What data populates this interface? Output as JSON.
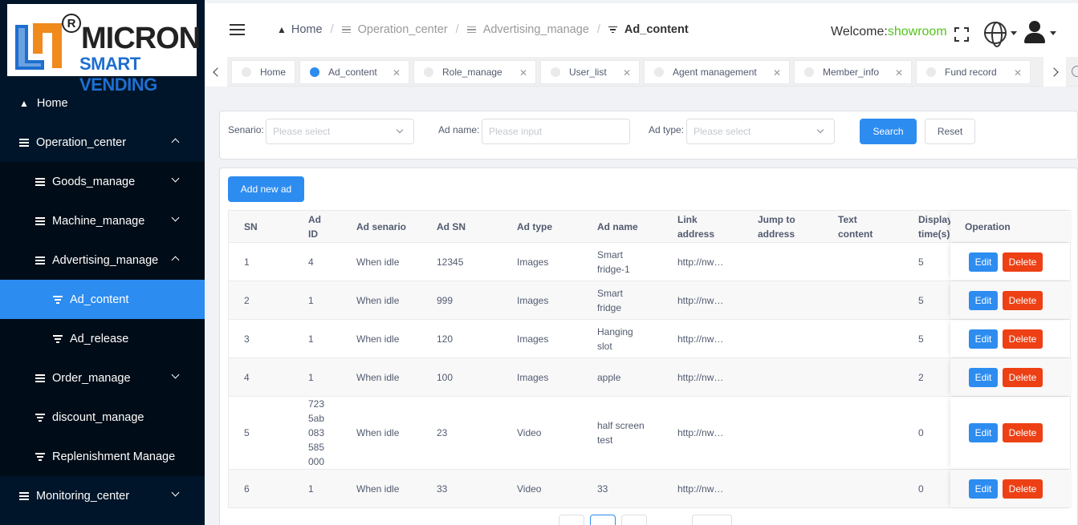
{
  "logo": {
    "mark_letters": "LM",
    "reg": "R",
    "brand": "MICRON",
    "tagline": "SMART VENDING"
  },
  "sidebar": {
    "items": [
      {
        "label": "Home"
      },
      {
        "label": "Operation_center"
      },
      {
        "label": "Goods_manage"
      },
      {
        "label": "Machine_manage"
      },
      {
        "label": "Advertising_manage"
      },
      {
        "label": "Ad_content"
      },
      {
        "label": "Ad_release"
      },
      {
        "label": "Order_manage"
      },
      {
        "label": "discount_manage"
      },
      {
        "label": "Replenishment Manage"
      },
      {
        "label": "Monitoring_center"
      }
    ]
  },
  "header": {
    "breadcrumb": [
      "Home",
      "Operation_center",
      "Advertising_manage",
      "Ad_content"
    ],
    "separator": "/",
    "welcome_prefix": "Welcome:",
    "username": "showroom"
  },
  "tags": [
    {
      "label": "Home"
    },
    {
      "label": "Ad_content"
    },
    {
      "label": "Role_manage"
    },
    {
      "label": "User_list"
    },
    {
      "label": "Agent management"
    },
    {
      "label": "Member_info"
    },
    {
      "label": "Fund record"
    }
  ],
  "search": {
    "senario_label": "Senario:",
    "senario_placeholder": "Please select",
    "adname_label": "Ad name:",
    "adname_placeholder": "Please input",
    "adtype_label": "Ad type:",
    "adtype_placeholder": "Please select",
    "search_label": "Search",
    "reset_label": "Reset"
  },
  "table": {
    "add_label": "Add new ad",
    "columns": [
      "SN",
      "Ad ID",
      "Ad senario",
      "Ad SN",
      "Ad type",
      "Ad name",
      "Link address",
      "Jump to address",
      "Text content",
      "Display time(s)",
      "Operation"
    ],
    "edit_label": "Edit",
    "delete_label": "Delete",
    "rows": [
      {
        "sn": "1",
        "ad_id": "4",
        "senario": "When idle",
        "ad_sn": "12345",
        "type": "Images",
        "name": "Smart fridge-1",
        "link": "http://nw…",
        "jump": "",
        "text": "",
        "time": "5"
      },
      {
        "sn": "2",
        "ad_id": "1",
        "senario": "When idle",
        "ad_sn": "999",
        "type": "Images",
        "name": "Smart fridge",
        "link": "http://nw…",
        "jump": "",
        "text": "",
        "time": "5"
      },
      {
        "sn": "3",
        "ad_id": "1",
        "senario": "When idle",
        "ad_sn": "120",
        "type": "Images",
        "name": "Hanging slot",
        "link": "http://nw…",
        "jump": "",
        "text": "",
        "time": "5"
      },
      {
        "sn": "4",
        "ad_id": "1",
        "senario": "When idle",
        "ad_sn": "100",
        "type": "Images",
        "name": "apple",
        "link": "http://nw…",
        "jump": "",
        "text": "",
        "time": "2"
      },
      {
        "sn": "5",
        "ad_id": "7235ab083585000",
        "senario": "When idle",
        "ad_sn": "23",
        "type": "Video",
        "name": "half screen test",
        "link": "http://nw…",
        "jump": "",
        "text": "",
        "time": "0"
      },
      {
        "sn": "6",
        "ad_id": "1",
        "senario": "When idle",
        "ad_sn": "33",
        "type": "Video",
        "name": "33",
        "link": "http://nw…",
        "jump": "",
        "text": "",
        "time": "0"
      }
    ]
  },
  "colors": {
    "sidebar_bg": "#001529",
    "submenu_bg": "#000c17",
    "accent": "#2d8cf0",
    "danger": "#ed4014",
    "welcome_user": "#52c41a"
  }
}
